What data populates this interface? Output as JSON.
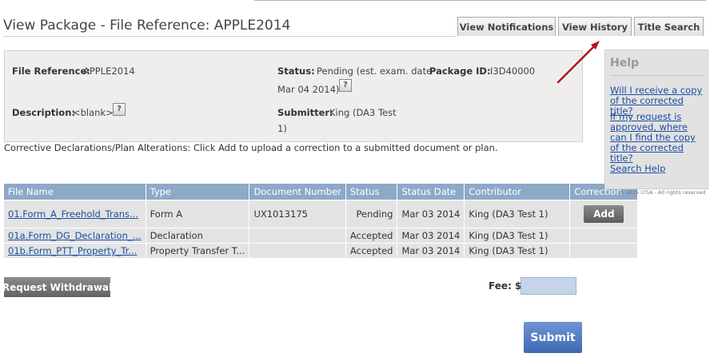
{
  "page_title": "View Package - File Reference: APPLE2014",
  "tabs": [
    {
      "label": "View Notifications"
    },
    {
      "label": "View History"
    },
    {
      "label": "Title Search"
    }
  ],
  "info": {
    "file_reference_label": "File Reference:",
    "file_reference_value": "APPLE2014",
    "status_label": "Status:",
    "status_value_line1": "Pending (est. exam. date",
    "status_value_line2": "Mar 04 2014)",
    "package_id_label": "Package ID:",
    "package_id_value": "I3D40000",
    "description_label": "Description:",
    "description_value": "<blank>",
    "submitter_label": "Submitter:",
    "submitter_value_line1": "King (DA3 Test",
    "submitter_value_line2": "1)"
  },
  "corrective_text": "Corrective Declarations/Plan Alterations: Click Add to upload a correction to a submitted document or plan.",
  "table": {
    "headers": [
      "File Name",
      "Type",
      "Document Number",
      "Status",
      "Status Date",
      "Contributor",
      "Correction"
    ],
    "rows": [
      {
        "file_name": "01.Form_A_Freehold_Trans...",
        "type": "Form A",
        "document_number": "UX1013175",
        "status": "Pending",
        "status_date": "Mar 03 2014",
        "contributor": "King (DA3 Test 1)",
        "correction": "Add"
      },
      {
        "file_name": "01a.Form_DG_Declaration_...",
        "type": "Declaration",
        "document_number": "",
        "status": "Accepted",
        "status_date": "Mar 03 2014",
        "contributor": "King (DA3 Test 1)",
        "correction": ""
      },
      {
        "file_name": "01b.Form_PTT_Property_Tr...",
        "type": "Property Transfer T...",
        "document_number": "",
        "status": "Accepted",
        "status_date": "Mar 03 2014",
        "contributor": "King (DA3 Test 1)",
        "correction": ""
      }
    ]
  },
  "withdraw_label": "Request Withdrawal",
  "fee_label": "Fee: $",
  "fee_value": "",
  "submit_label": "Submit",
  "help": {
    "title": "Help",
    "links": [
      "Will I receive a copy of the corrected title?",
      "If my request is approved, where can I find the copy of the corrected title?",
      "Search Help"
    ]
  },
  "copyright": "© 2015 LTSA - All rights reserved",
  "colors": {
    "header_blue": "#8da9c8",
    "link_blue": "#1a4fa3",
    "submit_blue": "#4a72bb",
    "arrow_red": "#b0151b"
  }
}
